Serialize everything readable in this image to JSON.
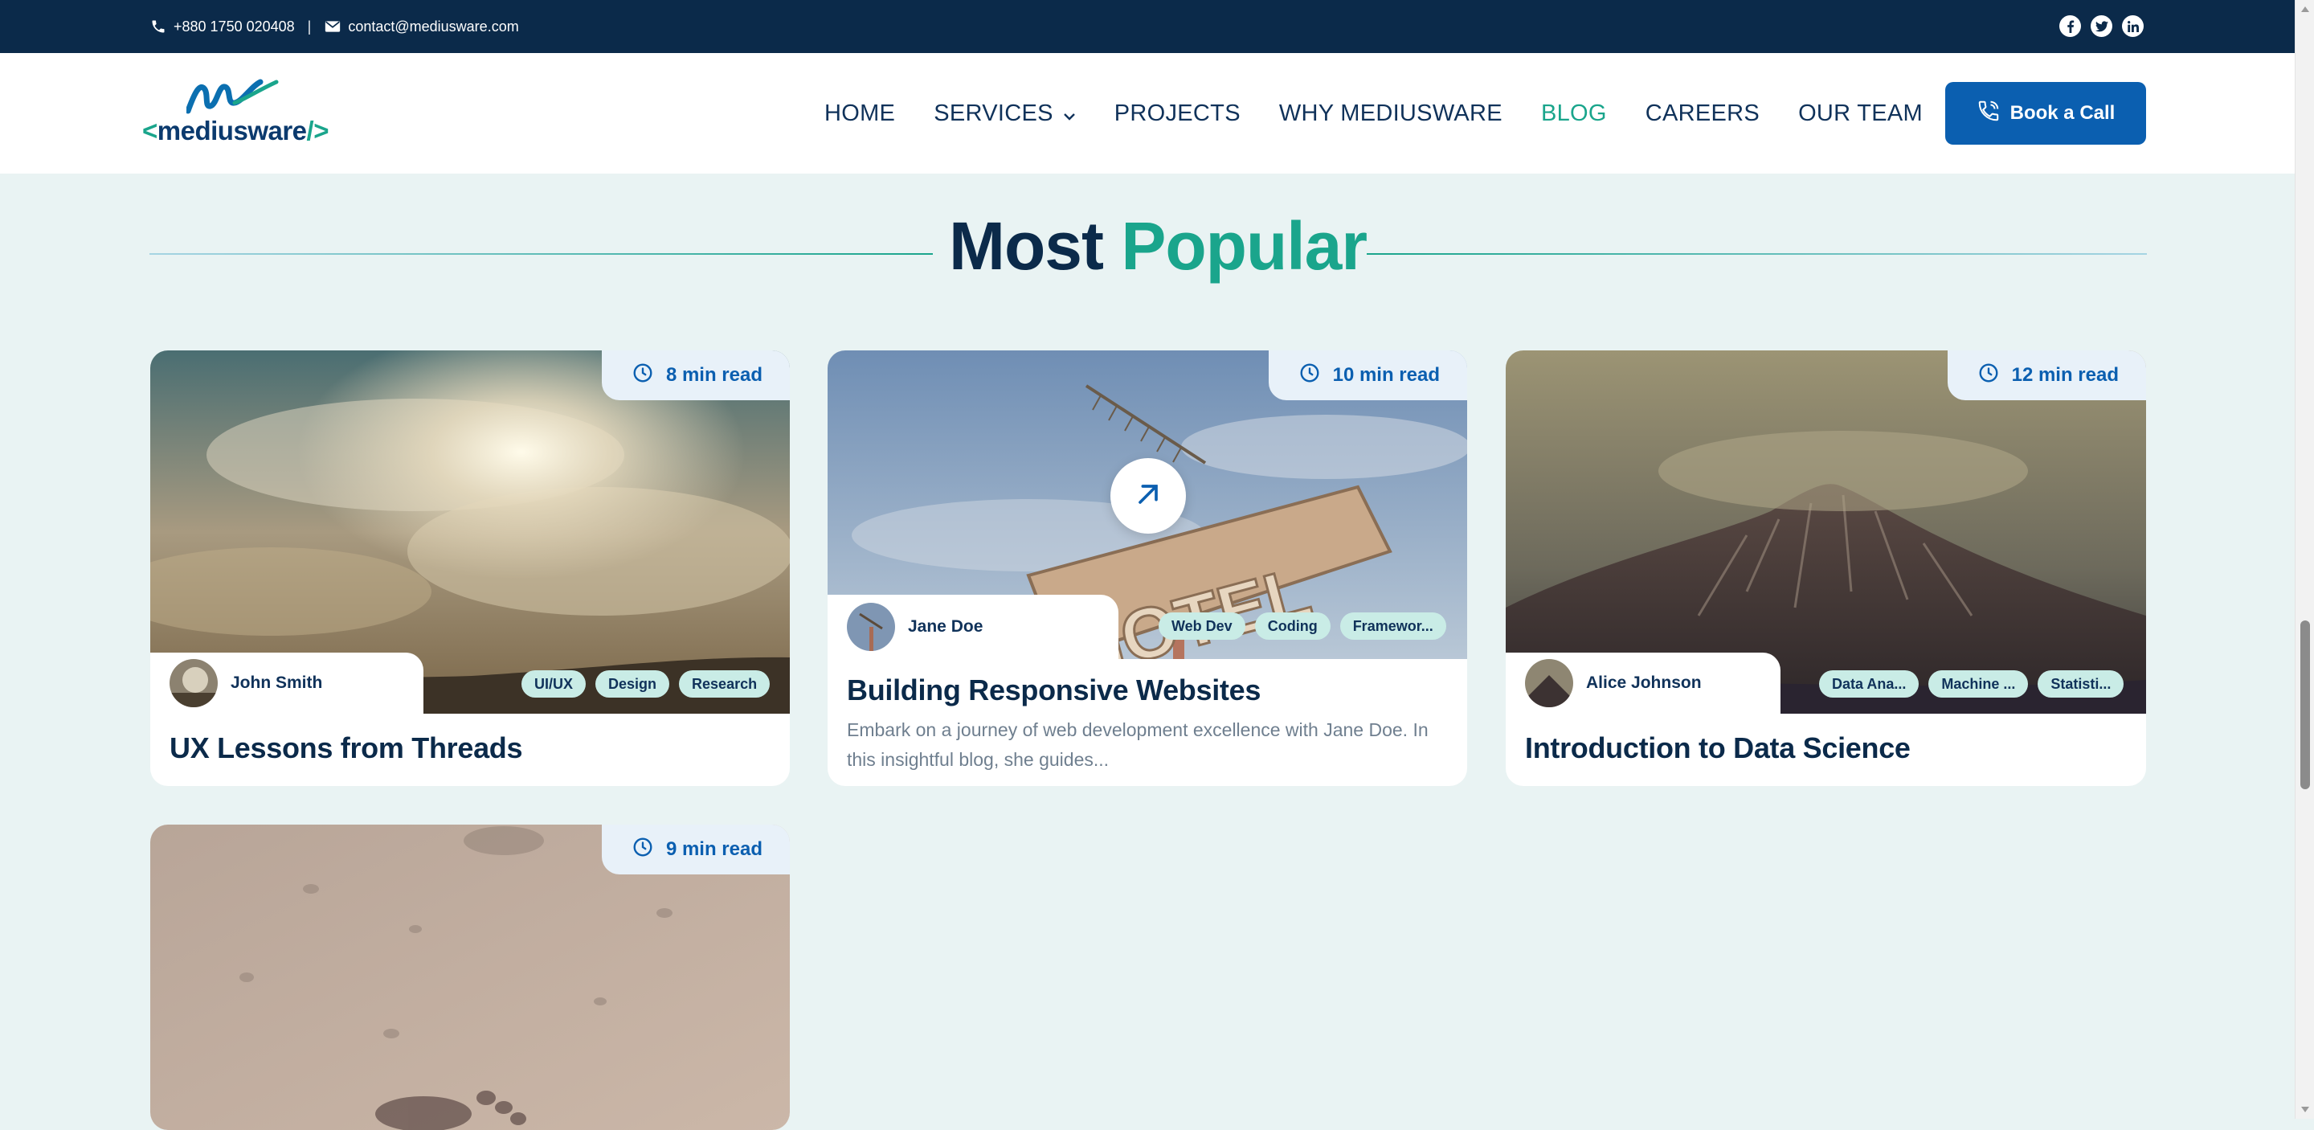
{
  "topbar": {
    "phone": "+880 1750 020408",
    "separator": "|",
    "email": "contact@mediusware.com",
    "social_icons": [
      "facebook-icon",
      "twitter-icon",
      "linkedin-icon"
    ]
  },
  "brand": {
    "logo_text_prefix": "<",
    "logo_text": "mediusware",
    "logo_text_suffix": "/>"
  },
  "nav": {
    "items": [
      {
        "label": "HOME",
        "active": false
      },
      {
        "label": "SERVICES",
        "active": false,
        "has_dropdown": true
      },
      {
        "label": "PROJECTS",
        "active": false
      },
      {
        "label": "WHY MEDIUSWARE",
        "active": false
      },
      {
        "label": "BLOG",
        "active": true
      },
      {
        "label": "CAREERS",
        "active": false
      },
      {
        "label": "OUR TEAM",
        "active": false
      }
    ],
    "cta_label": "Book a Call"
  },
  "section": {
    "title_part1": "Most",
    "title_part2": "Popular"
  },
  "cards": [
    {
      "read_time": "8 min read",
      "author": "John Smith",
      "tags": [
        "UI/UX",
        "Design",
        "Research"
      ],
      "title": "UX Lessons from Threads"
    },
    {
      "read_time": "10 min read",
      "author": "Jane Doe",
      "tags": [
        "Web Dev",
        "Coding",
        "Framewor..."
      ],
      "title": "Building Responsive Websites",
      "excerpt": "Embark on a journey of web development excellence with Jane Doe. In this insightful blog, she guides..."
    },
    {
      "read_time": "12 min read",
      "author": "Alice Johnson",
      "tags": [
        "Data Ana...",
        "Machine ...",
        "Statisti..."
      ],
      "title": "Introduction to Data Science"
    },
    {
      "read_time": "9 min read"
    }
  ],
  "colors": {
    "navy": "#0b2a4a",
    "teal": "#1aa58c",
    "blue": "#0b5fb0",
    "tag_bg": "#c9ece6",
    "page_bg": "#e9f3f3"
  }
}
